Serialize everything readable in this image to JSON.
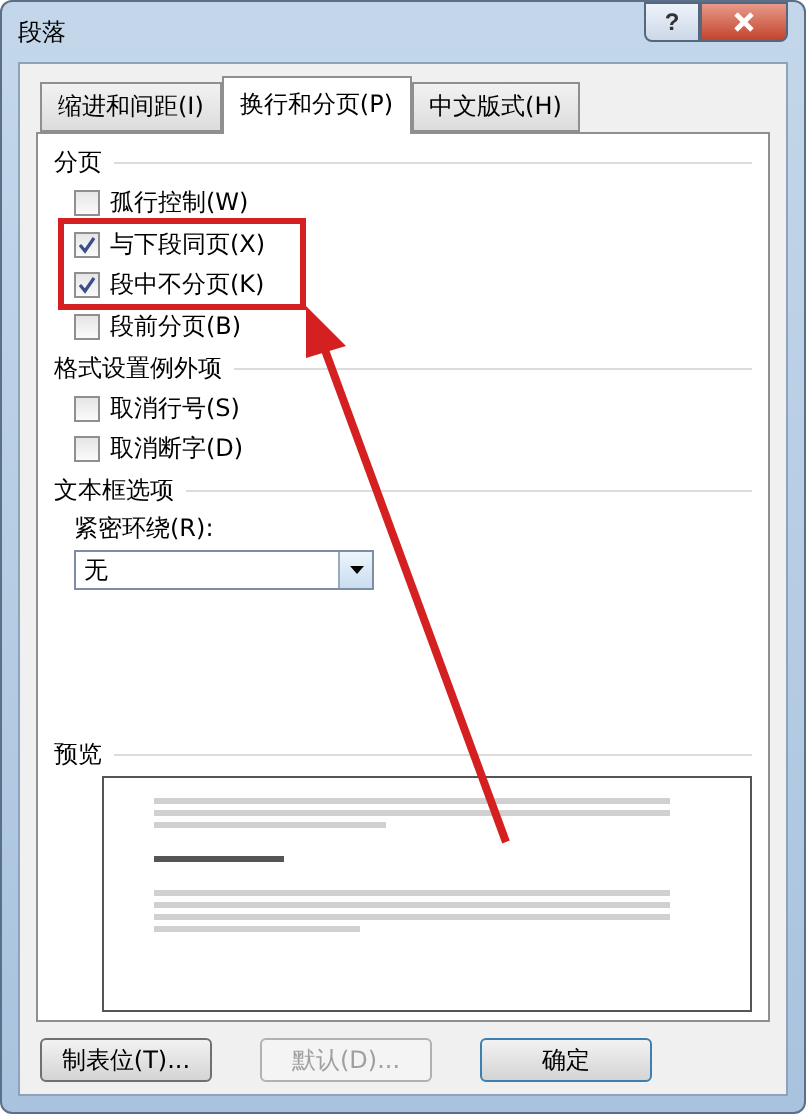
{
  "window": {
    "title": "段落",
    "help_button": "?"
  },
  "tabs": [
    {
      "label": "缩进和间距(I)",
      "selected": false
    },
    {
      "label": "换行和分页(P)",
      "selected": true
    },
    {
      "label": "中文版式(H)",
      "selected": false
    }
  ],
  "sections": [
    {
      "title": "分页",
      "options": [
        {
          "label": "孤行控制(W)",
          "checked": false
        },
        {
          "label": "与下段同页(X)",
          "checked": true,
          "highlighted": true
        },
        {
          "label": "段中不分页(K)",
          "checked": true,
          "highlighted": true
        },
        {
          "label": "段前分页(B)",
          "checked": false
        }
      ]
    },
    {
      "title": "格式设置例外项",
      "options": [
        {
          "label": "取消行号(S)",
          "checked": false
        },
        {
          "label": "取消断字(D)",
          "checked": false
        }
      ]
    }
  ],
  "textbox_options": {
    "title": "文本框选项",
    "field_label": "紧密环绕(R):",
    "value": "无"
  },
  "preview": {
    "title": "预览"
  },
  "buttons": [
    {
      "label": "制表位(T)...",
      "disabled": false,
      "default": false
    },
    {
      "label": "默认(D)...",
      "disabled": true,
      "default": false
    },
    {
      "label": "确定",
      "disabled": false,
      "default": true
    }
  ]
}
